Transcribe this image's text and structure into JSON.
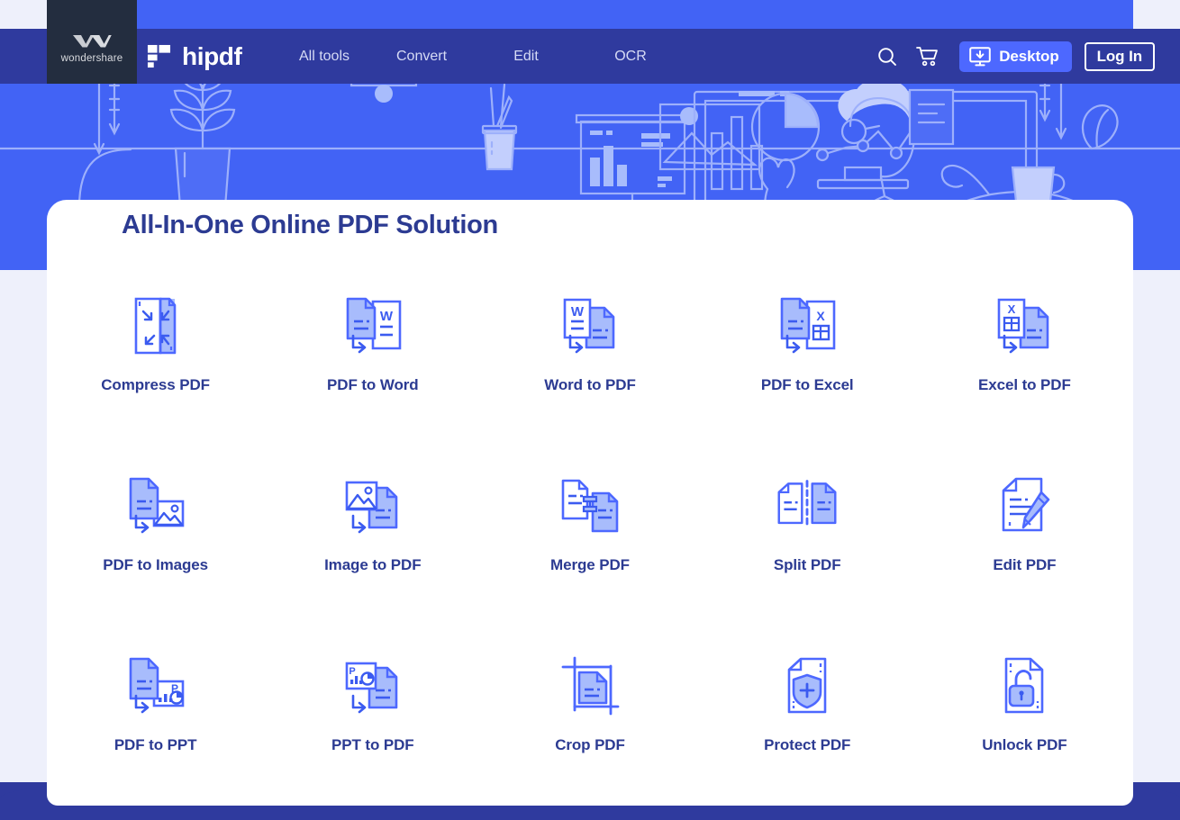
{
  "brand": {
    "company": "wondershare",
    "product": "hipdf",
    "company_logo_icon": "wondershare-w-icon",
    "product_logo_icon": "hipdf-mark-icon"
  },
  "nav": {
    "links": [
      {
        "label": "All tools",
        "name": "nav-link-all-tools"
      },
      {
        "label": "Convert",
        "name": "nav-link-convert"
      },
      {
        "label": "Edit",
        "name": "nav-link-edit"
      },
      {
        "label": "OCR",
        "name": "nav-link-ocr"
      }
    ],
    "search_icon": "search-icon",
    "cart_icon": "shopping-cart-icon",
    "desktop_button": {
      "label": "Desktop",
      "icon": "monitor-download-icon"
    },
    "login_button": {
      "label": "Log In"
    }
  },
  "hero": {
    "title": "All-In-One Online PDF Solution",
    "illustration": "workspace-line-art-illustration"
  },
  "tools": [
    {
      "label": "Compress PDF",
      "icon": "compress-pdf-icon"
    },
    {
      "label": "PDF to Word",
      "icon": "pdf-to-word-icon"
    },
    {
      "label": "Word to PDF",
      "icon": "word-to-pdf-icon"
    },
    {
      "label": "PDF to Excel",
      "icon": "pdf-to-excel-icon"
    },
    {
      "label": "Excel to PDF",
      "icon": "excel-to-pdf-icon"
    },
    {
      "label": "PDF to Images",
      "icon": "pdf-to-images-icon"
    },
    {
      "label": "Image to PDF",
      "icon": "image-to-pdf-icon"
    },
    {
      "label": "Merge PDF",
      "icon": "merge-pdf-icon"
    },
    {
      "label": "Split PDF",
      "icon": "split-pdf-icon"
    },
    {
      "label": "Edit PDF",
      "icon": "edit-pdf-icon"
    },
    {
      "label": "PDF to PPT",
      "icon": "pdf-to-ppt-icon"
    },
    {
      "label": "PPT to PDF",
      "icon": "ppt-to-pdf-icon"
    },
    {
      "label": "Crop PDF",
      "icon": "crop-pdf-icon"
    },
    {
      "label": "Protect PDF",
      "icon": "protect-pdf-icon"
    },
    {
      "label": "Unlock PDF",
      "icon": "unlock-pdf-icon"
    }
  ],
  "colors": {
    "page_background": "#eef0fb",
    "hero_blue": "#4263f5",
    "navbar_navy": "#2f3a9e",
    "badge_dark": "#232d3f",
    "title_navy": "#2c3b92",
    "icon_stroke": "#4d68ff",
    "icon_fill": "#a8bcfc",
    "desktop_button": "#4d68ff",
    "card_white": "#ffffff"
  }
}
